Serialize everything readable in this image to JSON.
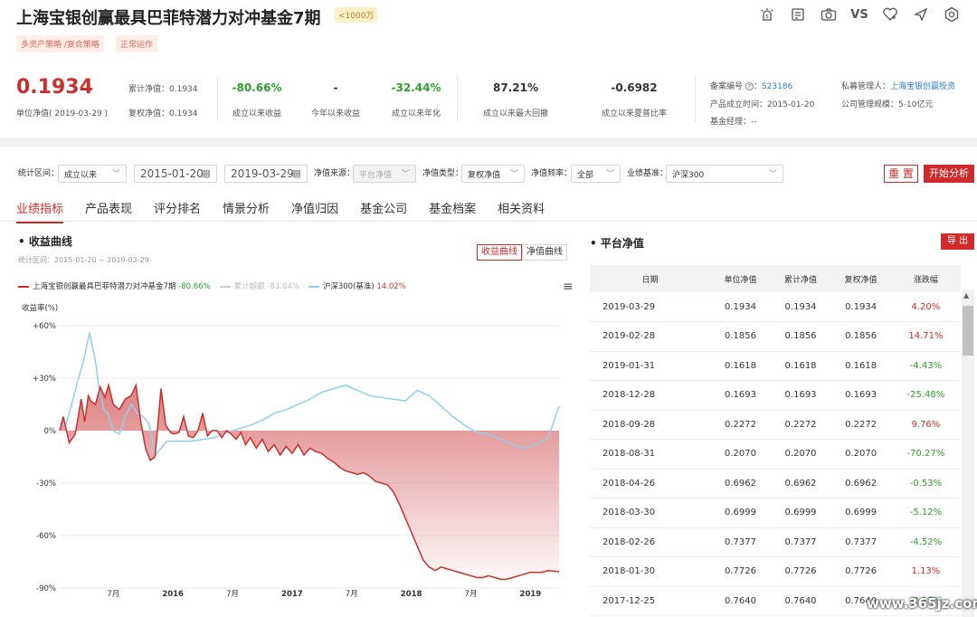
{
  "header": {
    "title": "上海宝银创赢最具巴菲特潜力对冲基金7期",
    "size_badge": "<1000万",
    "tags": [
      "多资产策略 /复合策略",
      "正常运作"
    ],
    "icons": [
      "alert-icon",
      "document-icon",
      "camera-icon",
      "vs-icon",
      "favorite-icon",
      "share-icon",
      "settings-icon"
    ],
    "vs_label": "VS"
  },
  "metrics": {
    "unit_nav": "0.1934",
    "unit_nav_label": "单位净值( 2019-03-29 )",
    "cum_nav_label": "累计净值：0.1934",
    "adj_nav_label": "复权净值：0.1934",
    "items": [
      {
        "value": "-80.66%",
        "label": "成立以来收益",
        "color": "green"
      },
      {
        "value": "-",
        "label": "今年以来收益",
        "color": "dark"
      },
      {
        "value": "-32.44%",
        "label": "成立以来年化",
        "color": "green"
      },
      {
        "value": "87.21%",
        "label": "成立以来最大回撤",
        "color": "dark"
      },
      {
        "value": "-0.6982",
        "label": "成立以来夏普比率",
        "color": "dark"
      }
    ],
    "record_label": "备案编号",
    "record_no": "S23186",
    "inception": "产品成立时间：2015-01-20",
    "manager_label": "基金经理：--",
    "pm_label": "私募管理人：",
    "pm_name": "上海宝银创赢投资",
    "scale": "公司管理规模：5-10亿元"
  },
  "filters": {
    "period_label": "统计区间：",
    "period_value": "成立以来",
    "start_date": "2015-01-20",
    "end_date": "2019-03-29",
    "source_label": "净值来源：",
    "source_value": "平台净值",
    "type_label": "净值类型：",
    "type_value": "复权净值",
    "freq_label": "净值频率：",
    "freq_value": "全部",
    "bench_label": "业绩基准：",
    "bench_value": "沪深300",
    "reset": "重 置",
    "start": "开始分析"
  },
  "tabs": [
    "业绩指标",
    "产品表现",
    "评分排名",
    "情景分析",
    "净值归因",
    "基金公司",
    "基金档案",
    "相关资料"
  ],
  "curve": {
    "title": "收益曲线",
    "range": "统计区间：2015-01-20 ~ 2019-03-29",
    "toggle_on": "收益曲线",
    "toggle_off": "净值曲线",
    "ylabel": "收益率(%)",
    "legend": [
      {
        "name": "上海宝银创赢最具巴菲特潜力对冲基金7期",
        "value": "-80.66%",
        "color": "#c9302c",
        "value_color": "#2ba02b"
      },
      {
        "name": "累计超额",
        "value": "-83.04%",
        "color": "#cccccc",
        "value_color": "#bbbbbb"
      },
      {
        "name": "沪深300(基准)",
        "value": "14.02%",
        "color": "#8fd0ee",
        "value_color": "#c9302c"
      }
    ]
  },
  "chart_data": {
    "type": "area",
    "ylabel": "收益率(%)",
    "ylim": [
      -90,
      60
    ],
    "yticks": [
      "+60%",
      "+30%",
      "0%",
      "-30%",
      "-60%",
      "-90%"
    ],
    "xticks": [
      "7月",
      "2016",
      "7月",
      "2017",
      "7月",
      "2018",
      "7月",
      "2019"
    ],
    "x_range": [
      "2015-01-20",
      "2019-03-29"
    ],
    "series": [
      {
        "name": "上海宝银创赢最具巴菲特潜力对冲基金7期",
        "x": [
          0,
          0.03,
          0.08,
          0.13,
          0.18,
          0.21,
          0.24,
          0.26,
          0.3,
          0.34,
          0.38,
          0.41,
          0.45,
          0.5,
          0.55,
          0.6,
          0.64,
          0.68,
          0.72,
          0.76,
          0.8,
          0.85,
          0.89,
          0.93,
          0.96,
          1.0,
          1.04,
          1.08,
          1.12,
          1.16,
          1.2,
          1.24,
          1.28,
          1.32,
          1.36,
          1.4,
          1.44,
          1.48,
          1.52,
          1.56,
          1.6,
          1.65,
          1.7,
          1.75,
          1.8,
          1.85,
          1.9,
          1.95,
          2.0,
          2.05,
          2.1,
          2.15,
          2.2,
          2.25,
          2.3,
          2.35,
          2.4,
          2.45,
          2.5,
          2.55,
          2.6,
          2.65,
          2.7,
          2.75,
          2.8,
          2.85,
          2.9,
          2.95,
          3.0,
          3.05,
          3.1,
          3.15,
          3.2,
          3.25,
          3.3,
          3.35,
          3.4,
          3.45,
          3.5,
          3.55,
          3.6,
          3.65,
          3.7,
          3.75,
          3.8,
          3.85,
          3.9,
          3.95,
          4.0,
          4.05,
          4.1,
          4.19
        ],
        "values": [
          0,
          8,
          -7,
          -2,
          18,
          5,
          20,
          17,
          15,
          25,
          19,
          26,
          15,
          12,
          18,
          20,
          26,
          5,
          -10,
          -17,
          -15,
          24,
          3,
          -1,
          -2,
          -1,
          8,
          -3,
          -4,
          0,
          10,
          -3,
          0,
          0,
          -4,
          0,
          -2,
          -5,
          -1,
          -8,
          -4,
          -10,
          -5,
          -12,
          -8,
          -14,
          -9,
          -13,
          -8,
          -14,
          -10,
          -12,
          -13,
          -16,
          -18,
          -21,
          -23,
          -24,
          -25,
          -24,
          -26,
          -29,
          -30,
          -31,
          -35,
          -42,
          -50,
          -58,
          -66,
          -74,
          -78,
          -80,
          -78,
          -79,
          -80,
          -81,
          -82,
          -83,
          -84,
          -84,
          -83,
          -84,
          -85,
          -85,
          -84,
          -83,
          -82,
          -81,
          -81,
          -81,
          -80,
          -80.66
        ]
      },
      {
        "name": "沪深300(基准)",
        "x": [
          0,
          0.05,
          0.1,
          0.15,
          0.2,
          0.25,
          0.3,
          0.33,
          0.37,
          0.4,
          0.45,
          0.5,
          0.55,
          0.6,
          0.65,
          0.7,
          0.75,
          0.8,
          0.85,
          0.9,
          0.95,
          1.0,
          1.1,
          1.2,
          1.3,
          1.4,
          1.5,
          1.6,
          1.7,
          1.8,
          1.9,
          2.0,
          2.1,
          2.2,
          2.3,
          2.4,
          2.5,
          2.6,
          2.7,
          2.8,
          2.9,
          3.0,
          3.1,
          3.2,
          3.3,
          3.4,
          3.5,
          3.6,
          3.7,
          3.8,
          3.9,
          4.0,
          4.1,
          4.19
        ],
        "values": [
          4,
          3,
          15,
          28,
          40,
          56,
          40,
          24,
          12,
          10,
          0,
          -2,
          8,
          15,
          10,
          8,
          4,
          -14,
          -10,
          -6,
          -6,
          -6,
          -6,
          -5,
          -4,
          -1,
          1,
          3,
          6,
          10,
          12,
          15,
          18,
          22,
          24,
          26,
          23,
          20,
          19,
          18,
          17,
          23,
          20,
          14,
          8,
          3,
          -1,
          -2,
          -5,
          -8,
          -10,
          -8,
          -4,
          14
        ]
      },
      {
        "name": "累计超额",
        "x": [],
        "values": []
      }
    ],
    "grid": true
  },
  "nav_table": {
    "title": "平台净值",
    "export": "导 出",
    "headers": [
      "日期",
      "单位净值",
      "累计净值",
      "复权净值",
      "涨跌幅"
    ],
    "rows": [
      [
        "2019-03-29",
        "0.1934",
        "0.1934",
        "0.1934",
        "4.20%"
      ],
      [
        "2019-02-28",
        "0.1856",
        "0.1856",
        "0.1856",
        "14.71%"
      ],
      [
        "2019-01-31",
        "0.1618",
        "0.1618",
        "0.1618",
        "-4.43%"
      ],
      [
        "2018-12-28",
        "0.1693",
        "0.1693",
        "0.1693",
        "-25.48%"
      ],
      [
        "2018-09-28",
        "0.2272",
        "0.2272",
        "0.2272",
        "9.76%"
      ],
      [
        "2018-08-31",
        "0.2070",
        "0.2070",
        "0.2070",
        "-70.27%"
      ],
      [
        "2018-04-26",
        "0.6962",
        "0.6962",
        "0.6962",
        "-0.53%"
      ],
      [
        "2018-03-30",
        "0.6999",
        "0.6999",
        "0.6999",
        "-5.12%"
      ],
      [
        "2018-02-26",
        "0.7377",
        "0.7377",
        "0.7377",
        "-4.52%"
      ],
      [
        "2018-01-30",
        "0.7726",
        "0.7726",
        "0.7726",
        "1.13%"
      ],
      [
        "2017-12-25",
        "0.7640",
        "0.7640",
        "0.7640",
        "-2.15%"
      ]
    ],
    "colors": {
      "up": "#d12a2a",
      "down": "#2ba02b"
    }
  },
  "watermark": "www.365jz.com"
}
